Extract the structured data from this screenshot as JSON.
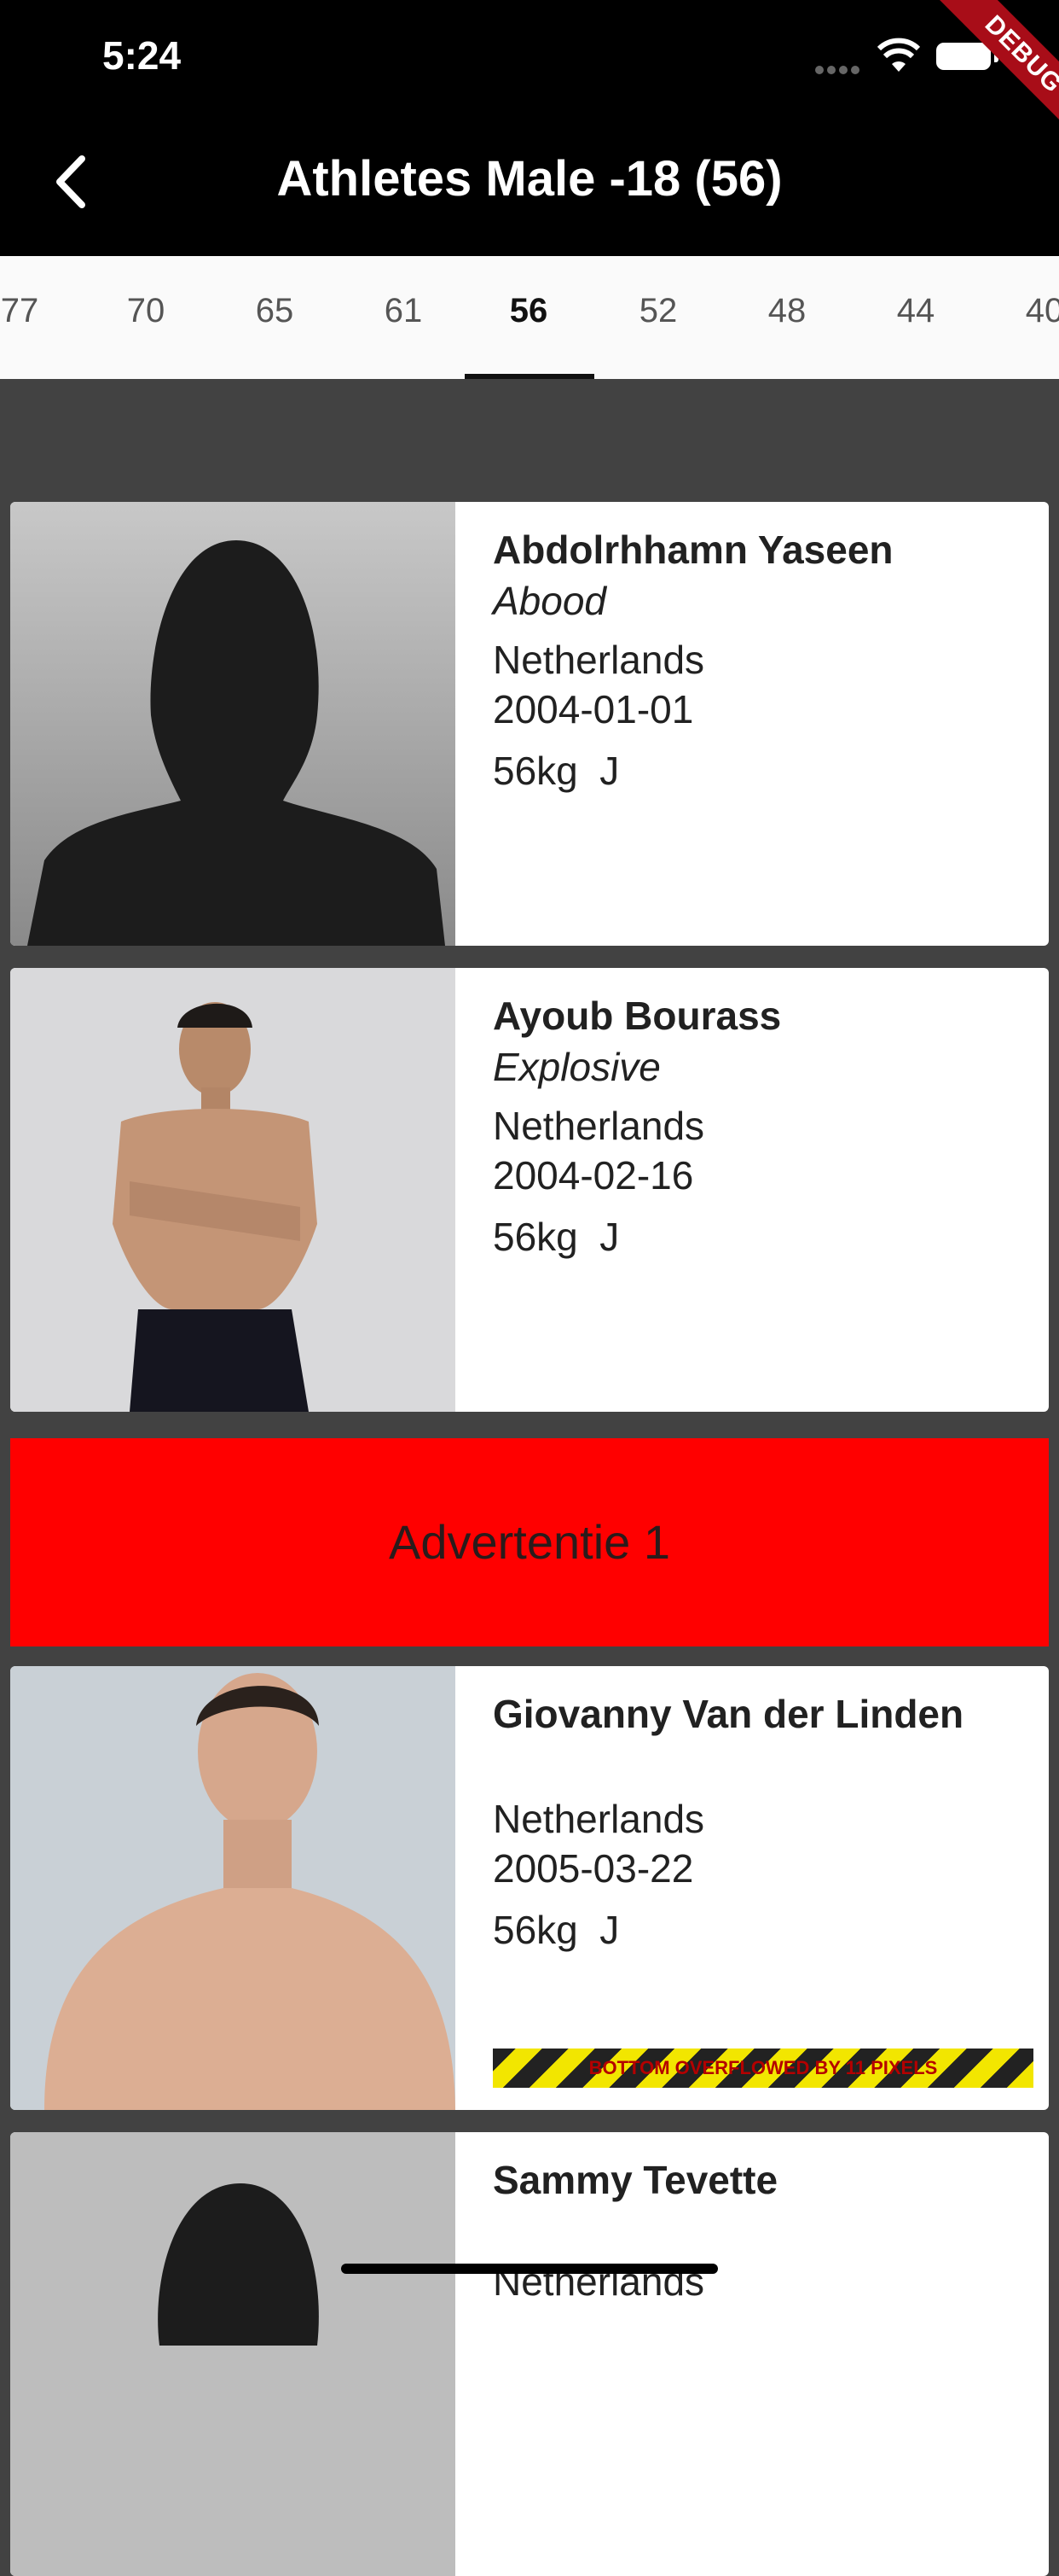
{
  "status": {
    "time": "5:24",
    "debug_label": "DEBUG"
  },
  "app_bar": {
    "title": "Athletes Male -18 (56)"
  },
  "tabs": [
    "77",
    "70",
    "65",
    "61",
    "56",
    "52",
    "48",
    "44",
    "40"
  ],
  "active_tab": "56",
  "athletes": [
    {
      "name": "Abdolrhhamn Yaseen",
      "nickname": "Abood",
      "country": "Netherlands",
      "dob": "2004-01-01",
      "weight_division": "56kg  J",
      "photo": "silhouette-placeholder"
    },
    {
      "name": "Ayoub Bourass",
      "nickname": "Explosive",
      "country": "Netherlands",
      "dob": "2004-02-16",
      "weight_division": "56kg  J",
      "photo": "athlete-photo"
    },
    {
      "name": "Giovanny Van der Linden",
      "nickname": "",
      "country": "Netherlands",
      "dob": "2005-03-22",
      "weight_division": "56kg  J",
      "photo": "athlete-photo",
      "overflow_warning": "BOTTOM OVERFLOWED BY 11 PIXELS"
    },
    {
      "name": "Sammy Tevette",
      "country": "Netherlands",
      "photo": "silhouette-placeholder"
    }
  ],
  "advertisement": {
    "label": "Advertentie 1",
    "color": "#ff0000"
  },
  "colors": {
    "app_bar": "#000000",
    "background": "#424242",
    "tab_bar": "#fafafa"
  }
}
